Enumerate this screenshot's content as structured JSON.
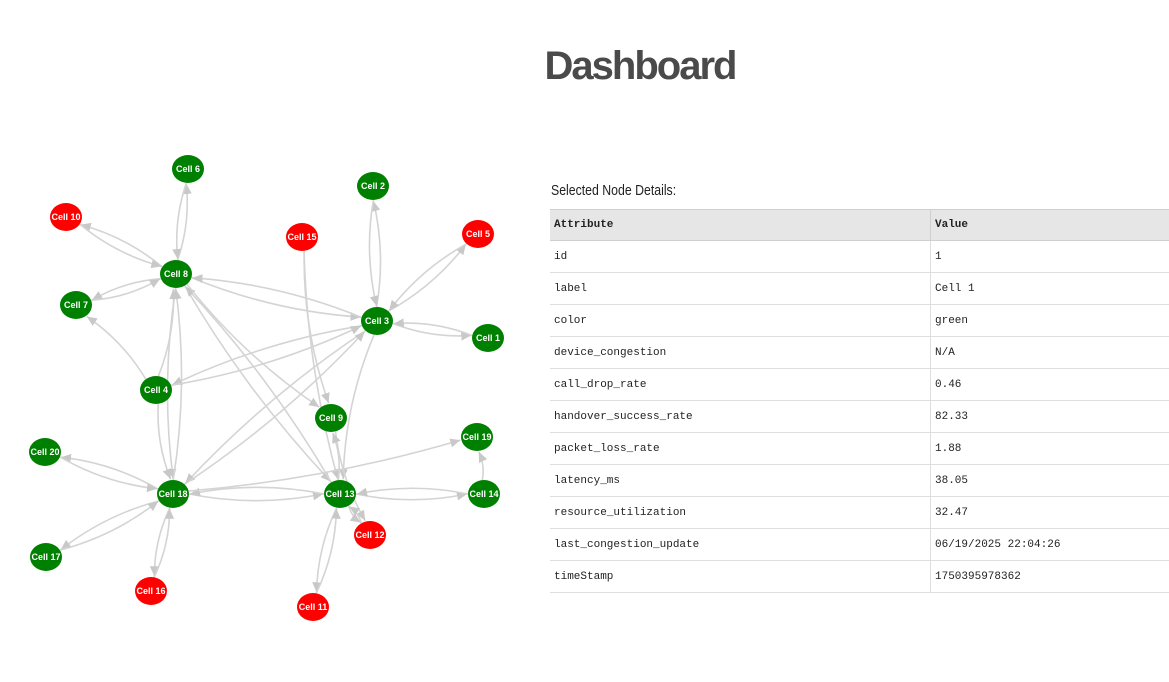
{
  "page": {
    "title": "Dashboard"
  },
  "graph": {
    "colors": {
      "green": "#008000",
      "red": "#ff0000",
      "edge": "#d4d4d4"
    },
    "nodes": [
      {
        "id": "1",
        "label": "Cell 1",
        "color": "green"
      },
      {
        "id": "2",
        "label": "Cell 2",
        "color": "green"
      },
      {
        "id": "3",
        "label": "Cell 3",
        "color": "green"
      },
      {
        "id": "4",
        "label": "Cell 4",
        "color": "green"
      },
      {
        "id": "5",
        "label": "Cell 5",
        "color": "red"
      },
      {
        "id": "6",
        "label": "Cell 6",
        "color": "green"
      },
      {
        "id": "7",
        "label": "Cell 7",
        "color": "green"
      },
      {
        "id": "8",
        "label": "Cell 8",
        "color": "green"
      },
      {
        "id": "9",
        "label": "Cell 9",
        "color": "green"
      },
      {
        "id": "10",
        "label": "Cell 10",
        "color": "red"
      },
      {
        "id": "11",
        "label": "Cell 11",
        "color": "red"
      },
      {
        "id": "12",
        "label": "Cell 12",
        "color": "red"
      },
      {
        "id": "13",
        "label": "Cell 13",
        "color": "green"
      },
      {
        "id": "14",
        "label": "Cell 14",
        "color": "green"
      },
      {
        "id": "15",
        "label": "Cell 15",
        "color": "red"
      },
      {
        "id": "16",
        "label": "Cell 16",
        "color": "red"
      },
      {
        "id": "17",
        "label": "Cell 17",
        "color": "green"
      },
      {
        "id": "18",
        "label": "Cell 18",
        "color": "green"
      },
      {
        "id": "19",
        "label": "Cell 19",
        "color": "green"
      },
      {
        "id": "20",
        "label": "Cell 20",
        "color": "green"
      }
    ],
    "edges": [
      [
        "8",
        "6"
      ],
      [
        "6",
        "8"
      ],
      [
        "8",
        "10"
      ],
      [
        "10",
        "8"
      ],
      [
        "8",
        "7"
      ],
      [
        "7",
        "8"
      ],
      [
        "4",
        "7"
      ],
      [
        "8",
        "3"
      ],
      [
        "3",
        "8"
      ],
      [
        "8",
        "18"
      ],
      [
        "18",
        "8"
      ],
      [
        "4",
        "8"
      ],
      [
        "8",
        "13"
      ],
      [
        "13",
        "8"
      ],
      [
        "8",
        "9"
      ],
      [
        "3",
        "2"
      ],
      [
        "2",
        "3"
      ],
      [
        "3",
        "5"
      ],
      [
        "5",
        "3"
      ],
      [
        "3",
        "1"
      ],
      [
        "1",
        "3"
      ],
      [
        "3",
        "4"
      ],
      [
        "4",
        "3"
      ],
      [
        "3",
        "18"
      ],
      [
        "18",
        "3"
      ],
      [
        "3",
        "13"
      ],
      [
        "15",
        "9"
      ],
      [
        "15",
        "13"
      ],
      [
        "9",
        "12"
      ],
      [
        "13",
        "9"
      ],
      [
        "13",
        "12"
      ],
      [
        "12",
        "13"
      ],
      [
        "13",
        "11"
      ],
      [
        "11",
        "13"
      ],
      [
        "13",
        "14"
      ],
      [
        "14",
        "13"
      ],
      [
        "18",
        "13"
      ],
      [
        "13",
        "18"
      ],
      [
        "18",
        "19"
      ],
      [
        "14",
        "19"
      ],
      [
        "18",
        "20"
      ],
      [
        "20",
        "18"
      ],
      [
        "18",
        "17"
      ],
      [
        "17",
        "18"
      ],
      [
        "18",
        "16"
      ],
      [
        "16",
        "18"
      ],
      [
        "4",
        "18"
      ]
    ]
  },
  "details": {
    "heading": "Selected Node Details:",
    "columns": [
      "Attribute",
      "Value"
    ],
    "rows": [
      [
        "id",
        "1"
      ],
      [
        "label",
        "Cell 1"
      ],
      [
        "color",
        "green"
      ],
      [
        "device_congestion",
        "N/A"
      ],
      [
        "call_drop_rate",
        "0.46"
      ],
      [
        "handover_success_rate",
        "82.33"
      ],
      [
        "packet_loss_rate",
        "1.88"
      ],
      [
        "latency_ms",
        "38.05"
      ],
      [
        "resource_utilization",
        "32.47"
      ],
      [
        "last_congestion_update",
        "06/19/2025 22:04:26"
      ],
      [
        "timeStamp",
        "1750395978362"
      ]
    ]
  }
}
